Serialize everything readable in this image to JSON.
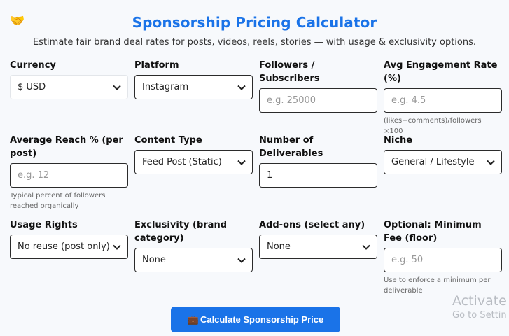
{
  "header": {
    "icon": "handshake-icon",
    "title": "Sponsorship Pricing Calculator",
    "subtitle": "Estimate fair brand deal rates for posts, videos, reels, stories — with usage & exclusivity options."
  },
  "fields": {
    "currency": {
      "label": "Currency",
      "value": "$ USD"
    },
    "platform": {
      "label": "Platform",
      "value": "Instagram"
    },
    "followers": {
      "label": "Followers / Subscribers",
      "placeholder": "e.g. 25000"
    },
    "engagement": {
      "label": "Avg Engagement Rate (%)",
      "placeholder": "e.g. 4.5",
      "help": "(likes+comments)/followers ×100"
    },
    "reach": {
      "label": "Average Reach % (per post)",
      "placeholder": "e.g. 12",
      "help": "Typical percent of followers reached organically"
    },
    "content_type": {
      "label": "Content Type",
      "value": "Feed Post (Static)"
    },
    "deliverables": {
      "label": "Number of Deliverables",
      "value": "1"
    },
    "niche": {
      "label": "Niche",
      "value": "General / Lifestyle"
    },
    "usage_rights": {
      "label": "Usage Rights",
      "value": "No reuse (post only)"
    },
    "exclusivity": {
      "label": "Exclusivity (brand category)",
      "value": "None"
    },
    "addons": {
      "label": "Add-ons (select any)",
      "value": "None"
    },
    "min_fee": {
      "label": "Optional: Minimum Fee (floor)",
      "placeholder": "e.g. 50",
      "help": "Use to enforce a minimum per deliverable"
    }
  },
  "cta": {
    "icon": "briefcase-icon",
    "label": "Calculate Sponsorship Price"
  },
  "watermark": {
    "line1": "Activate W",
    "line2": "Go to Settin"
  },
  "colors": {
    "accent": "#1a73e8",
    "text": "#111111",
    "background": "#f7f9fc"
  }
}
